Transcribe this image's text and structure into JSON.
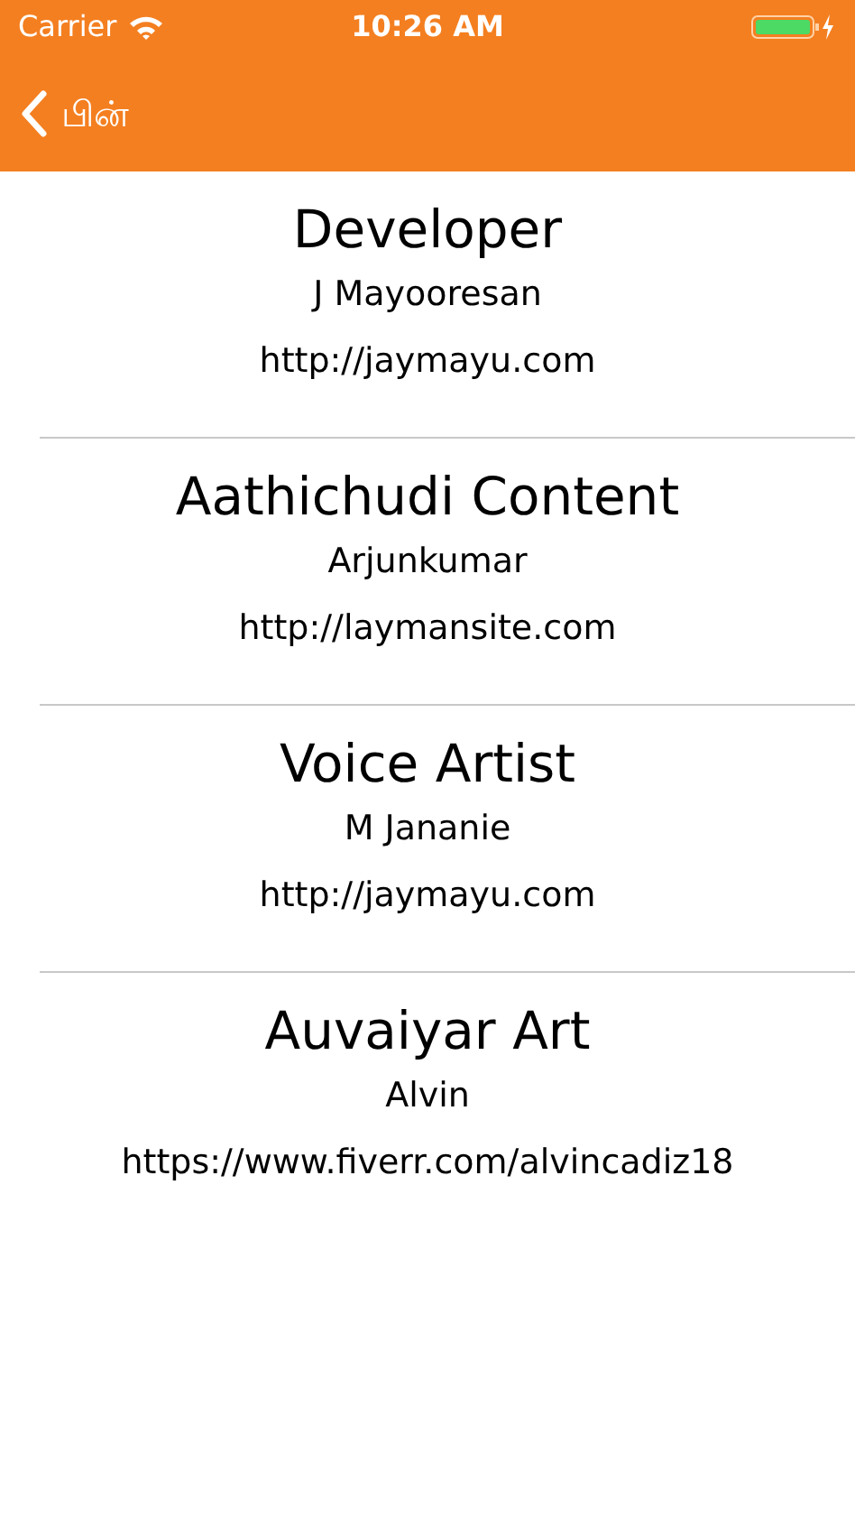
{
  "status_bar": {
    "carrier": "Carrier",
    "time": "10:26 AM"
  },
  "nav": {
    "back": "பின்"
  },
  "credits": [
    {
      "role": "Developer",
      "name": "J Mayooresan",
      "url": "http://jaymayu.com"
    },
    {
      "role": "Aathichudi Content",
      "name": "Arjunkumar",
      "url": "http://laymansite.com"
    },
    {
      "role": "Voice Artist",
      "name": "M Jananie",
      "url": "http://jaymayu.com"
    },
    {
      "role": "Auvaiyar Art",
      "name": "Alvin",
      "url": "https://www.fiverr.com/alvincadiz18"
    }
  ]
}
